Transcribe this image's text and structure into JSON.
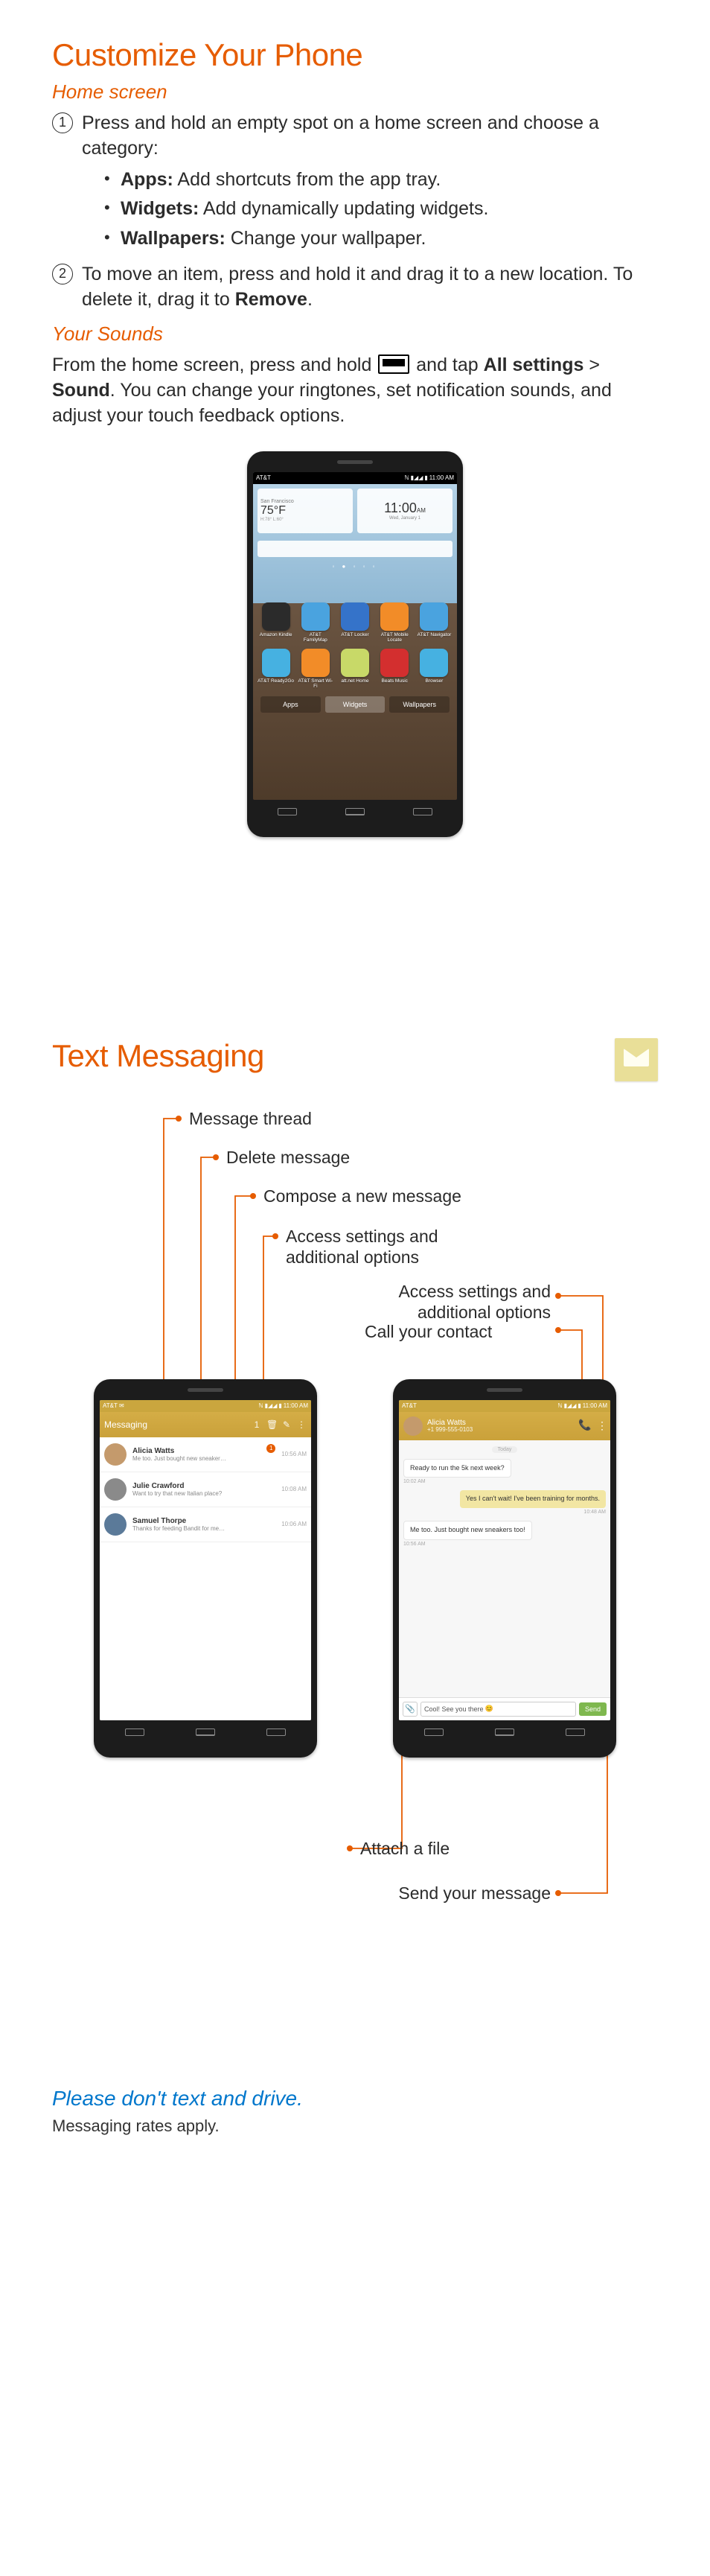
{
  "section1": {
    "title": "Customize Your Phone",
    "home_screen_heading": "Home screen",
    "step1_intro": "Press and hold an empty spot on a home screen and choose a category:",
    "bullets": [
      {
        "label": "Apps:",
        "text": " Add shortcuts from the app tray."
      },
      {
        "label": "Widgets:",
        "text": " Add dynamically updating widgets."
      },
      {
        "label": "Wallpapers:",
        "text": " Change your wallpaper."
      }
    ],
    "step2_a": "To move an item, press and hold it and drag it to a new location. To delete it, drag it to ",
    "step2_b": "Remove",
    "step2_c": ".",
    "sounds_heading": "Your Sounds",
    "sounds_a": "From the home screen, press and hold ",
    "sounds_b": " and tap ",
    "sounds_c": "All settings",
    "sounds_d": " > ",
    "sounds_e": "Sound",
    "sounds_f": ". You can change your ringtones, set notification sounds, and adjust your touch feedback options."
  },
  "homemock": {
    "carrier": "AT&T",
    "time": "11:00 AM",
    "weather_city": "San Francisco",
    "weather_temp": "75°F",
    "weather_unit": "H:78° L:60°",
    "clock_time": "11:00",
    "clock_ampm": "AM",
    "clock_day": "Wed, January 1",
    "apps_row1": [
      {
        "label": "Amazon Kindle",
        "color": "#2b2b2b"
      },
      {
        "label": "AT&T FamilyMap",
        "color": "#4aa3df"
      },
      {
        "label": "AT&T Locker",
        "color": "#3573c9"
      },
      {
        "label": "AT&T Mobile Locate",
        "color": "#f28c28"
      },
      {
        "label": "AT&T Navigator",
        "color": "#4aa3df"
      }
    ],
    "apps_row2": [
      {
        "label": "AT&T Ready2Go",
        "color": "#46b1e1"
      },
      {
        "label": "AT&T Smart Wi-Fi",
        "color": "#f28c28"
      },
      {
        "label": "att.net Home",
        "color": "#c8d968"
      },
      {
        "label": "Beats Music",
        "color": "#d32f2f"
      },
      {
        "label": "Browser",
        "color": "#46b1e1"
      }
    ],
    "tabs": {
      "apps": "Apps",
      "widgets": "Widgets",
      "wallpapers": "Wallpapers"
    }
  },
  "section2": {
    "title": "Text Messaging",
    "callouts": {
      "thread": "Message thread",
      "delete": "Delete message",
      "compose": "Compose a new message",
      "settings_left": "Access settings and additional options",
      "settings_right": "Access settings and additional options",
      "call": "Call your contact",
      "attach": "Attach a file",
      "send": "Send your message"
    },
    "left_phone": {
      "carrier": "AT&T",
      "time": "11:00 AM",
      "header_title": "Messaging",
      "header_count": "1",
      "conversations": [
        {
          "name": "Alicia Watts",
          "preview": "Me too. Just bought new sneaker…",
          "time": "10:56 AM",
          "badge": "1",
          "av": "#c49a6c"
        },
        {
          "name": "Julie Crawford",
          "preview": "Want to try that new Italian place?",
          "time": "10:08 AM",
          "av": "#8a8a8a"
        },
        {
          "name": "Samuel Thorpe",
          "preview": "Thanks for feeding Bandit for me…",
          "time": "10:06 AM",
          "av": "#5b7a99"
        }
      ]
    },
    "right_phone": {
      "carrier": "AT&T",
      "time": "11:00 AM",
      "contact_name": "Alicia Watts",
      "contact_phone": "+1 999-555-0103",
      "day": "Today",
      "messages": [
        {
          "dir": "in",
          "text": "Ready to run the 5k next week?",
          "time": "10:02 AM"
        },
        {
          "dir": "out",
          "text": "Yes I can't wait! I've been training for months.",
          "time": "10:48 AM"
        },
        {
          "dir": "in",
          "text": "Me too. Just bought new sneakers too!",
          "time": "10:56 AM"
        }
      ],
      "compose_text": "Cool! See you there",
      "send_label": "Send"
    },
    "footer_heading": "Please don't text and drive.",
    "footer_fine": "Messaging rates apply."
  }
}
